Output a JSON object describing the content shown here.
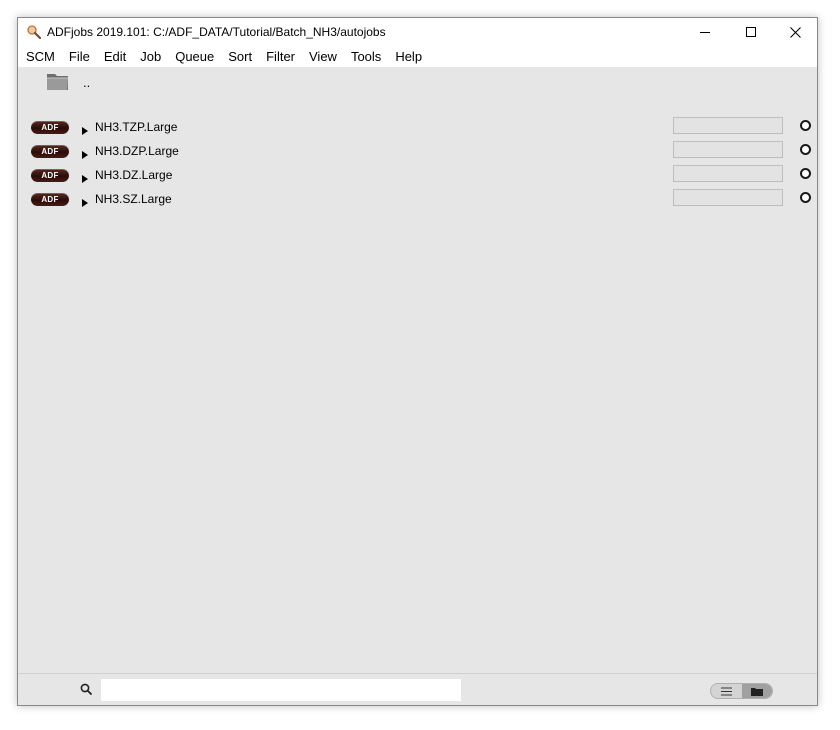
{
  "window": {
    "title": "ADFjobs 2019.101: C:/ADF_DATA/Tutorial/Batch_NH3/autojobs",
    "buttons": {
      "minimize": "minimize-icon",
      "maximize": "maximize-icon",
      "close": "close-icon"
    }
  },
  "menubar": {
    "items": [
      "SCM",
      "File",
      "Edit",
      "Job",
      "Queue",
      "Sort",
      "Filter",
      "View",
      "Tools",
      "Help"
    ]
  },
  "parent_folder": {
    "label": ".."
  },
  "jobs": [
    {
      "badge": "ADF",
      "name": "NH3.TZP.Large"
    },
    {
      "badge": "ADF",
      "name": "NH3.DZP.Large"
    },
    {
      "badge": "ADF",
      "name": "NH3.DZ.Large"
    },
    {
      "badge": "ADF",
      "name": "NH3.SZ.Large"
    }
  ],
  "search": {
    "value": "",
    "placeholder": ""
  },
  "colors": {
    "badge": "#3a120c",
    "content_bg": "#e6e6e6",
    "window_border": "#6a8fb5"
  }
}
